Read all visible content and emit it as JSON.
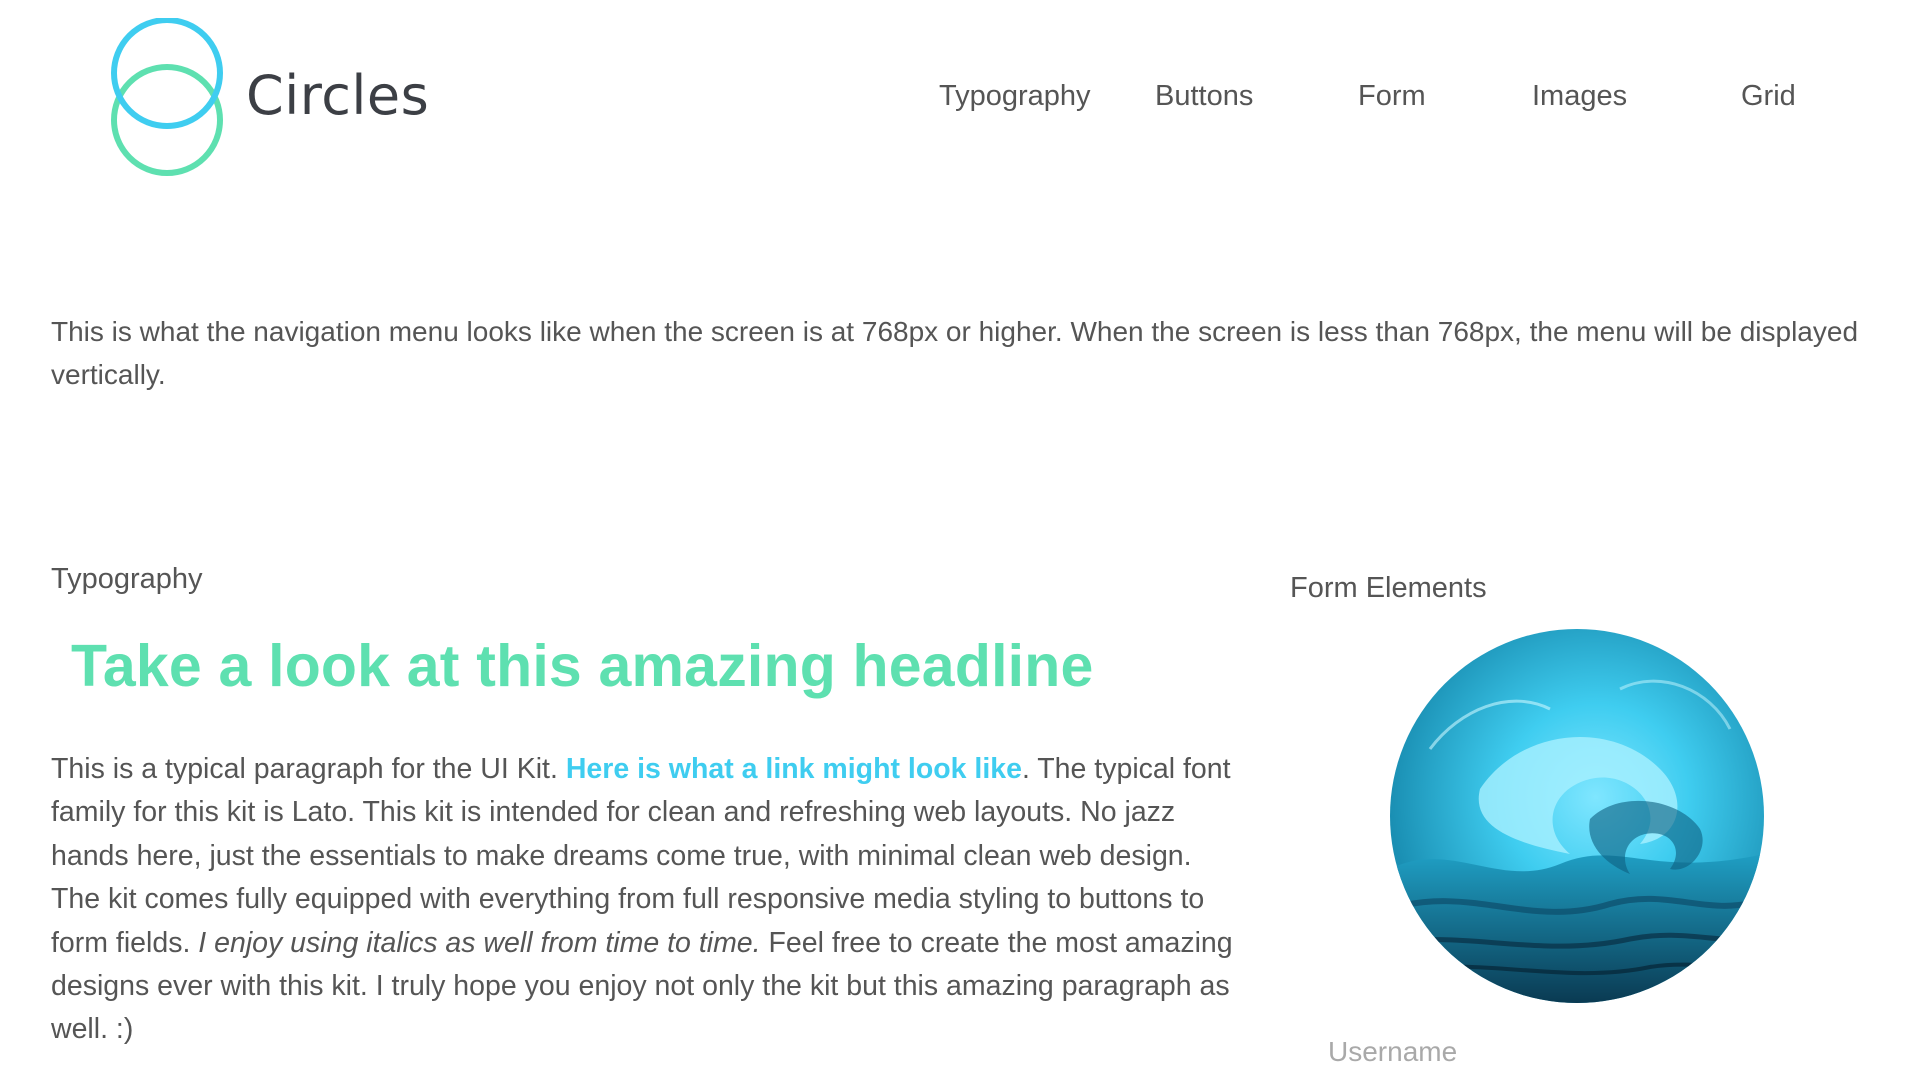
{
  "header": {
    "brand": "Circles",
    "logo_colors": {
      "ring_top": "#3fcdf0",
      "ring_bottom": "#5ee0b0"
    },
    "nav": [
      {
        "label": "Typography"
      },
      {
        "label": "Buttons"
      },
      {
        "label": "Form"
      },
      {
        "label": "Images"
      },
      {
        "label": "Grid"
      }
    ]
  },
  "intro": {
    "text": "This is what the navigation menu looks like when the screen is at 768px or higher. When the screen is less than 768px, the menu will be displayed vertically."
  },
  "typography": {
    "section_label": "Typography",
    "headline": "Take a look at this amazing headline",
    "paragraph": {
      "before_link": "This is a typical paragraph for the UI Kit. ",
      "link_text": "Here is what a link might look like",
      "after_link": ". The typical font family for this kit is Lato. This kit is intended for clean and refreshing web layouts. No jazz hands here, just the essentials to make dreams come true, with minimal clean web design. The kit comes fully equipped with everything from full responsive media styling to buttons to form fields. ",
      "italic_text": "I enjoy using italics as well from time to time.",
      "closing": " Feel free to create the most amazing designs ever with this kit. I truly hope you enjoy not only the kit but this amazing paragraph as well. :)"
    }
  },
  "form_elements": {
    "section_label": "Form Elements",
    "image_icon": "ocean-wave-image",
    "username_label": "Username"
  },
  "colors": {
    "headline": "#5ee0b0",
    "link": "#3fcdf0",
    "text": "#555555",
    "muted": "#a9a9a9"
  }
}
